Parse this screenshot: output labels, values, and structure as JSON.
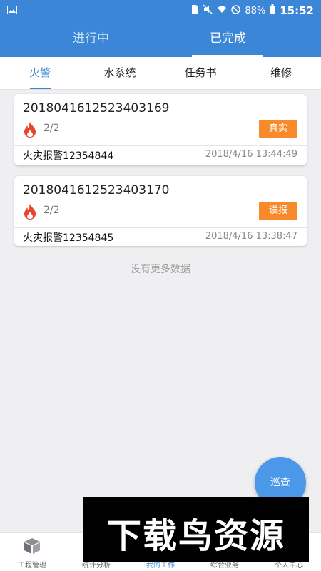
{
  "status_bar": {
    "battery": "88%",
    "time": "15:52"
  },
  "top_tabs": [
    {
      "label": "进行中",
      "active": false
    },
    {
      "label": "已完成",
      "active": true
    }
  ],
  "sub_tabs": [
    {
      "label": "火警",
      "active": true
    },
    {
      "label": "水系统",
      "active": false
    },
    {
      "label": "任务书",
      "active": false
    },
    {
      "label": "维修",
      "active": false
    }
  ],
  "records": [
    {
      "code": "2018041612523403169",
      "count": "2/2",
      "tag": "真实",
      "title": "火灾报警12354844",
      "time": "2018/4/16 13:44:49"
    },
    {
      "code": "2018041612523403170",
      "count": "2/2",
      "tag": "误报",
      "title": "火灾报警12354845",
      "time": "2018/4/16 13:38:47"
    }
  ],
  "no_more_text": "没有更多数据",
  "fab_label": "巡查",
  "bottom_nav": [
    {
      "label": "工程管理",
      "active": false
    },
    {
      "label": "统计分析",
      "active": false
    },
    {
      "label": "我的工作",
      "active": true
    },
    {
      "label": "综合业务",
      "active": false
    },
    {
      "label": "个人中心",
      "active": false
    }
  ],
  "watermark_text": "下载鸟资源",
  "colors": {
    "primary": "#3b86d6",
    "tag_orange": "#f98a2b",
    "fire_red": "#e8452c"
  }
}
